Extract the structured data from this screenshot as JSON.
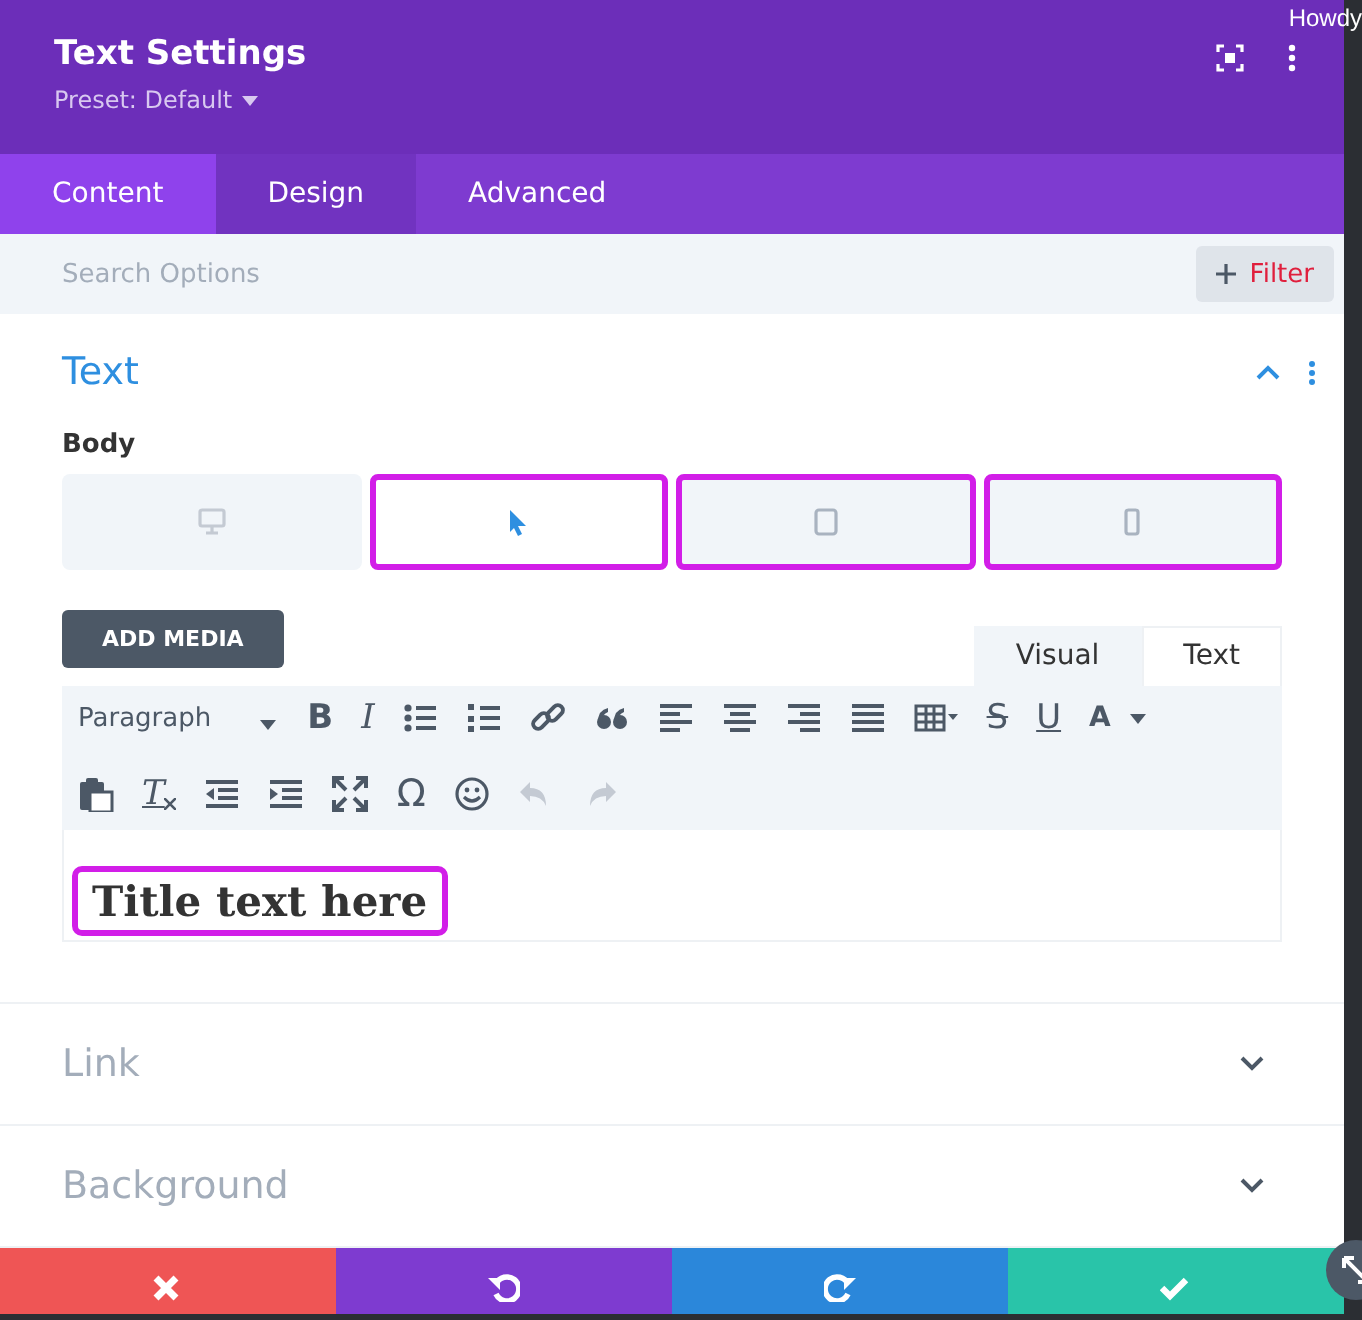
{
  "corner_text": "Howdy",
  "header": {
    "title": "Text Settings",
    "preset": "Preset: Default"
  },
  "tabs": [
    {
      "label": "Content",
      "selected": true,
      "hover": false
    },
    {
      "label": "Design",
      "selected": false,
      "hover": true
    },
    {
      "label": "Advanced",
      "selected": false,
      "hover": false
    }
  ],
  "search": {
    "placeholder": "Search Options",
    "filter_label": "Filter"
  },
  "sections": [
    {
      "title": "Text",
      "expanded": true,
      "field_label": "Body",
      "devices": [
        {
          "kind": "desktop",
          "selected": false,
          "highlighted": false
        },
        {
          "kind": "cursor",
          "selected": true,
          "highlighted": true
        },
        {
          "kind": "tablet",
          "selected": false,
          "highlighted": true
        },
        {
          "kind": "phone",
          "selected": false,
          "highlighted": true
        }
      ],
      "add_media": "ADD MEDIA",
      "editor_tabs": [
        {
          "label": "Visual",
          "selected": false
        },
        {
          "label": "Text",
          "selected": true
        }
      ],
      "format": "Paragraph",
      "toolbar": [
        [
          {
            "kind": "bold",
            "glyph": "B",
            "disabled": false
          },
          {
            "kind": "italic",
            "glyph": "I",
            "disabled": false
          },
          {
            "kind": "bullets",
            "disabled": false
          },
          {
            "kind": "numbers",
            "disabled": false
          },
          {
            "kind": "link",
            "disabled": false
          },
          {
            "kind": "quote",
            "disabled": false
          },
          {
            "kind": "left",
            "disabled": false
          },
          {
            "kind": "center",
            "disabled": false
          },
          {
            "kind": "right",
            "disabled": false
          },
          {
            "kind": "justify",
            "disabled": false
          },
          {
            "kind": "table",
            "disabled": false
          },
          {
            "kind": "strike",
            "glyph": "S",
            "disabled": false
          },
          {
            "kind": "underline",
            "glyph": "U",
            "disabled": false
          },
          {
            "kind": "color",
            "glyph": "A",
            "disabled": false
          }
        ],
        [
          {
            "kind": "paste",
            "disabled": false
          },
          {
            "kind": "clear",
            "glyph": "T",
            "disabled": false
          },
          {
            "kind": "outdent",
            "disabled": false
          },
          {
            "kind": "indent",
            "disabled": false
          },
          {
            "kind": "fullscreen",
            "disabled": false
          },
          {
            "kind": "omega",
            "glyph": "Ω",
            "disabled": false
          },
          {
            "kind": "emoji",
            "disabled": false
          },
          {
            "kind": "undo",
            "disabled": true
          },
          {
            "kind": "redo",
            "disabled": true
          }
        ]
      ],
      "content": "Title text here",
      "content_highlighted": true
    },
    {
      "title": "Link",
      "expanded": false
    },
    {
      "title": "Background",
      "expanded": false
    }
  ],
  "footer": [
    {
      "kind": "cancel",
      "color": "#ef5555"
    },
    {
      "kind": "undo",
      "color": "#7e3bd0"
    },
    {
      "kind": "redo",
      "color": "#2b87da"
    },
    {
      "kind": "save",
      "color": "#29c4a9"
    }
  ]
}
